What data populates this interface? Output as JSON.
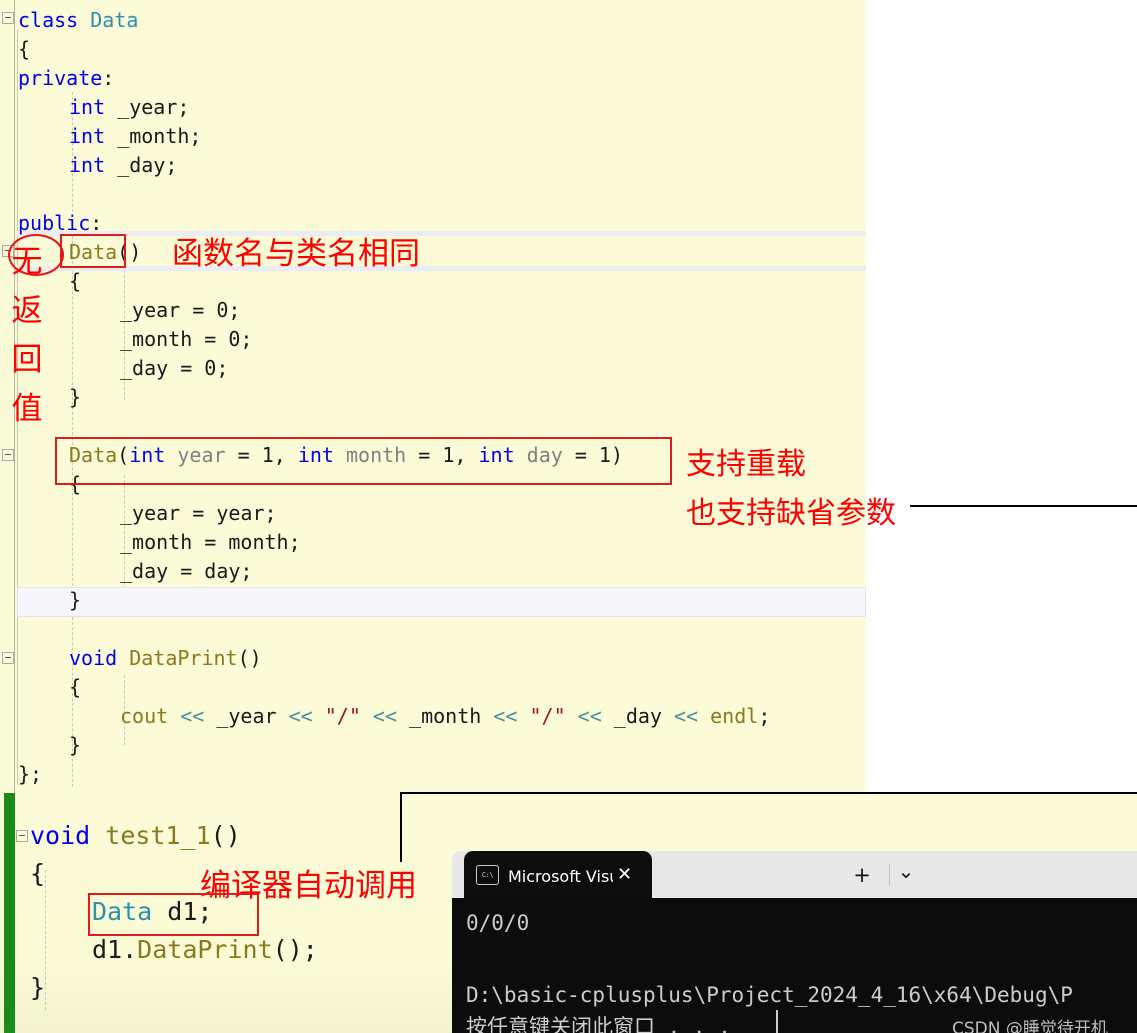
{
  "editor": {
    "background": "#fbfbd8",
    "lines_top": [
      {
        "indent": 0,
        "segs": [
          {
            "t": "class ",
            "c": "kw"
          },
          {
            "t": "Data",
            "c": "type-user"
          }
        ]
      },
      {
        "indent": 0,
        "segs": [
          {
            "t": "{",
            "c": "plain"
          }
        ]
      },
      {
        "indent": 0,
        "segs": [
          {
            "t": "private",
            "c": "kw"
          },
          {
            "t": ":",
            "c": "plain"
          }
        ]
      },
      {
        "indent": 1,
        "segs": [
          {
            "t": "int",
            "c": "kw"
          },
          {
            "t": " _year;",
            "c": "plain"
          }
        ]
      },
      {
        "indent": 1,
        "segs": [
          {
            "t": "int",
            "c": "kw"
          },
          {
            "t": " _month;",
            "c": "plain"
          }
        ]
      },
      {
        "indent": 1,
        "segs": [
          {
            "t": "int",
            "c": "kw"
          },
          {
            "t": " _day;",
            "c": "plain"
          }
        ]
      },
      {
        "indent": 0,
        "segs": []
      },
      {
        "indent": 0,
        "segs": [
          {
            "t": "public",
            "c": "kw"
          },
          {
            "t": ":",
            "c": "plain"
          }
        ]
      },
      {
        "indent": 1,
        "segs": [
          {
            "t": "Data",
            "c": "fn"
          },
          {
            "t": "()",
            "c": "plain"
          }
        ]
      },
      {
        "indent": 1,
        "segs": [
          {
            "t": "{",
            "c": "plain"
          }
        ]
      },
      {
        "indent": 2,
        "segs": [
          {
            "t": "_year = 0;",
            "c": "plain"
          }
        ]
      },
      {
        "indent": 2,
        "segs": [
          {
            "t": "_month = 0;",
            "c": "plain"
          }
        ]
      },
      {
        "indent": 2,
        "segs": [
          {
            "t": "_day = 0;",
            "c": "plain"
          }
        ]
      },
      {
        "indent": 1,
        "segs": [
          {
            "t": "}",
            "c": "plain"
          }
        ]
      },
      {
        "indent": 0,
        "segs": []
      },
      {
        "indent": 1,
        "segs": [
          {
            "t": "Data",
            "c": "fn"
          },
          {
            "t": "(",
            "c": "plain"
          },
          {
            "t": "int",
            "c": "kw"
          },
          {
            "t": " ",
            "c": "plain"
          },
          {
            "t": "year",
            "c": "param"
          },
          {
            "t": " = ",
            "c": "plain"
          },
          {
            "t": "1",
            "c": "num"
          },
          {
            "t": ", ",
            "c": "plain"
          },
          {
            "t": "int",
            "c": "kw"
          },
          {
            "t": " ",
            "c": "plain"
          },
          {
            "t": "month",
            "c": "param"
          },
          {
            "t": " = ",
            "c": "plain"
          },
          {
            "t": "1",
            "c": "num"
          },
          {
            "t": ", ",
            "c": "plain"
          },
          {
            "t": "int",
            "c": "kw"
          },
          {
            "t": " ",
            "c": "plain"
          },
          {
            "t": "day",
            "c": "param"
          },
          {
            "t": " = ",
            "c": "plain"
          },
          {
            "t": "1",
            "c": "num"
          },
          {
            "t": ")",
            "c": "plain"
          }
        ]
      },
      {
        "indent": 1,
        "segs": [
          {
            "t": "{",
            "c": "plain"
          }
        ]
      },
      {
        "indent": 2,
        "segs": [
          {
            "t": "_year = year;",
            "c": "plain"
          }
        ]
      },
      {
        "indent": 2,
        "segs": [
          {
            "t": "_month = month;",
            "c": "plain"
          }
        ]
      },
      {
        "indent": 2,
        "segs": [
          {
            "t": "_day = day;",
            "c": "plain"
          }
        ]
      },
      {
        "indent": 1,
        "segs": [
          {
            "t": "}",
            "c": "plain"
          }
        ]
      },
      {
        "indent": 0,
        "segs": []
      },
      {
        "indent": 1,
        "segs": [
          {
            "t": "void",
            "c": "kw"
          },
          {
            "t": " ",
            "c": "plain"
          },
          {
            "t": "DataPrint",
            "c": "fn"
          },
          {
            "t": "()",
            "c": "plain"
          }
        ]
      },
      {
        "indent": 1,
        "segs": [
          {
            "t": "{",
            "c": "plain"
          }
        ]
      },
      {
        "indent": 2,
        "segs": [
          {
            "t": "cout ",
            "c": "fn"
          },
          {
            "t": "<<",
            "c": "op"
          },
          {
            "t": " _year ",
            "c": "plain"
          },
          {
            "t": "<<",
            "c": "op"
          },
          {
            "t": " ",
            "c": "plain"
          },
          {
            "t": "\"/\"",
            "c": "str"
          },
          {
            "t": " ",
            "c": "plain"
          },
          {
            "t": "<<",
            "c": "op"
          },
          {
            "t": " _month ",
            "c": "plain"
          },
          {
            "t": "<<",
            "c": "op"
          },
          {
            "t": " ",
            "c": "plain"
          },
          {
            "t": "\"/\"",
            "c": "str"
          },
          {
            "t": " ",
            "c": "plain"
          },
          {
            "t": "<<",
            "c": "op"
          },
          {
            "t": " _day ",
            "c": "plain"
          },
          {
            "t": "<<",
            "c": "op"
          },
          {
            "t": " ",
            "c": "plain"
          },
          {
            "t": "endl",
            "c": "fn"
          },
          {
            "t": ";",
            "c": "plain"
          }
        ]
      },
      {
        "indent": 1,
        "segs": [
          {
            "t": "}",
            "c": "plain"
          }
        ]
      },
      {
        "indent": 0,
        "segs": [
          {
            "t": "};",
            "c": "plain"
          }
        ]
      }
    ],
    "lines_bottom": [
      {
        "indent": 0,
        "segs": [
          {
            "t": "void",
            "c": "kw"
          },
          {
            "t": " ",
            "c": "plain"
          },
          {
            "t": "test1_1",
            "c": "fn"
          },
          {
            "t": "()",
            "c": "plain"
          }
        ]
      },
      {
        "indent": 0,
        "segs": [
          {
            "t": "{",
            "c": "plain"
          }
        ]
      },
      {
        "indent": 1,
        "segs": [
          {
            "t": "Data",
            "c": "type-user"
          },
          {
            "t": " d1;",
            "c": "plain"
          }
        ]
      },
      {
        "indent": 1,
        "segs": [
          {
            "t": "d1",
            "c": "plain"
          },
          {
            "t": ".",
            "c": "plain"
          },
          {
            "t": "DataPrint",
            "c": "fn"
          },
          {
            "t": "();",
            "c": "plain"
          }
        ]
      },
      {
        "indent": 0,
        "segs": [
          {
            "t": "}",
            "c": "plain"
          }
        ]
      }
    ]
  },
  "annotations": {
    "no_return_value": "无返回值",
    "same_as_class_name": "函数名与类名相同",
    "supports_overload": "支持重载",
    "supports_default_args": "也支持缺省参数",
    "compiler_auto_call": "编译器自动调用",
    "color": "#ff0000"
  },
  "console": {
    "tab_title": "Microsoft Visual Studio 调试控",
    "tab_icon_label": "C:\\",
    "close_label": "✕",
    "new_tab_label": "+",
    "dropdown_label": "⌄",
    "output_line1": "0/0/0",
    "output_line2": "D:\\basic-cplusplus\\Project_2024_4_16\\x64\\Debug\\P",
    "output_line3": "按任意键关闭此窗口 . . .",
    "background": "#0c0c0c",
    "titlebar_background": "#e8e8e8"
  },
  "watermark": {
    "text": "CSDN @睡觉待开机"
  }
}
